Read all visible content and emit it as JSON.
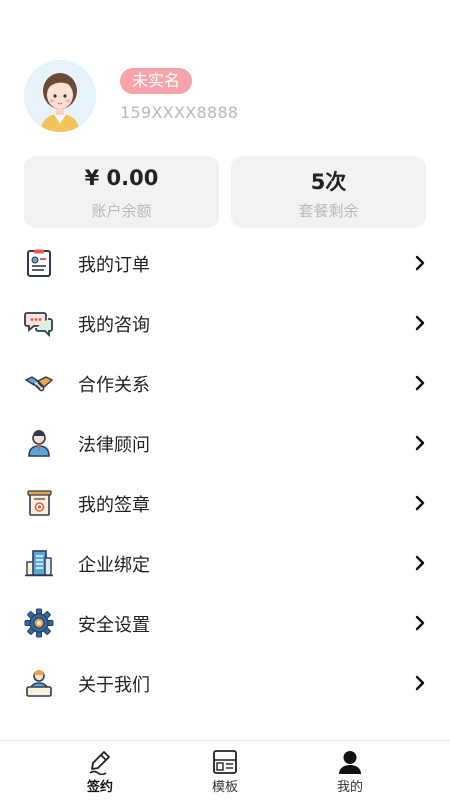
{
  "profile": {
    "verification_badge": "未实名",
    "phone": "159XXXX8888"
  },
  "stats": {
    "balance_value": "¥ 0.00",
    "balance_label": "账户余额",
    "package_value": "5次",
    "package_label": "套餐剩余"
  },
  "menu": [
    {
      "label": "我的订单",
      "icon": "order-clipboard-icon"
    },
    {
      "label": "我的咨询",
      "icon": "chat-bubbles-icon"
    },
    {
      "label": "合作关系",
      "icon": "handshake-icon"
    },
    {
      "label": "法律顾问",
      "icon": "lawyer-icon"
    },
    {
      "label": "我的签章",
      "icon": "seal-document-icon"
    },
    {
      "label": "企业绑定",
      "icon": "building-icon"
    },
    {
      "label": "安全设置",
      "icon": "gear-icon"
    },
    {
      "label": "关于我们",
      "icon": "team-icon"
    }
  ],
  "tabs": [
    {
      "label": "签约",
      "icon": "pen-sign-icon",
      "active": true
    },
    {
      "label": "模板",
      "icon": "template-icon",
      "active": false
    },
    {
      "label": "我的",
      "icon": "user-icon",
      "active": false
    }
  ],
  "colors": {
    "badge": "#f6a4aa",
    "card_bg": "#f2f2f4",
    "muted_text": "#b9b9bd",
    "icon_blue": "#2b6cb0",
    "icon_orange": "#f0a14a",
    "icon_red": "#e05a4f"
  }
}
